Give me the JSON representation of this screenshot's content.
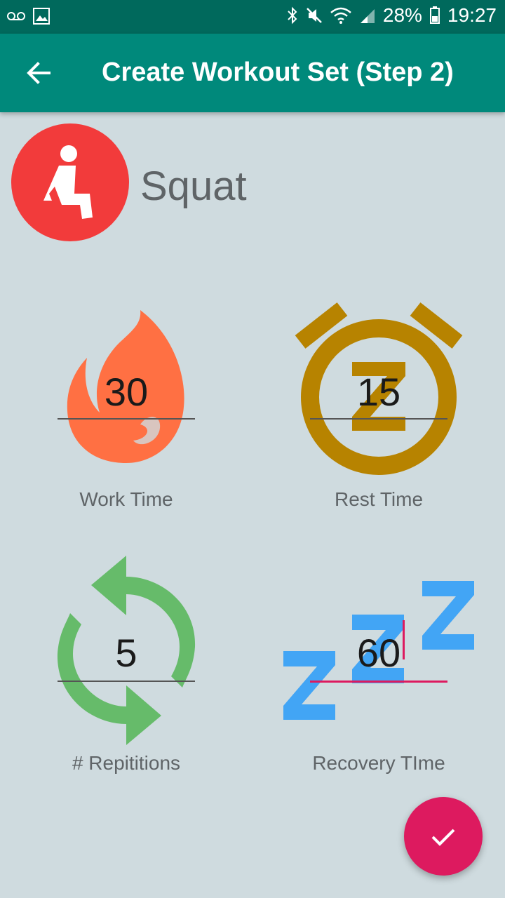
{
  "status_bar": {
    "battery": "28%",
    "time": "19:27"
  },
  "app_bar": {
    "title": "Create Workout Set (Step 2)"
  },
  "exercise": {
    "name": "Squat",
    "icon": "squat-icon",
    "color": "#f23b3b"
  },
  "fields": {
    "work_time": {
      "value": "30",
      "label": "Work Time",
      "icon": "flame-icon",
      "color": "#ff7043"
    },
    "rest_time": {
      "value": "15",
      "label": "Rest Time",
      "icon": "alarm-snooze-icon",
      "color": "#b78300"
    },
    "repetitions": {
      "value": "5",
      "label": "# Repititions",
      "icon": "repeat-icon",
      "color": "#66bb6a"
    },
    "recovery_time": {
      "value": "60",
      "label": "Recovery TIme",
      "icon": "sleep-zzz-icon",
      "color": "#42a5f5"
    }
  },
  "fab": {
    "icon": "check-icon",
    "color": "#dd1a5f"
  }
}
